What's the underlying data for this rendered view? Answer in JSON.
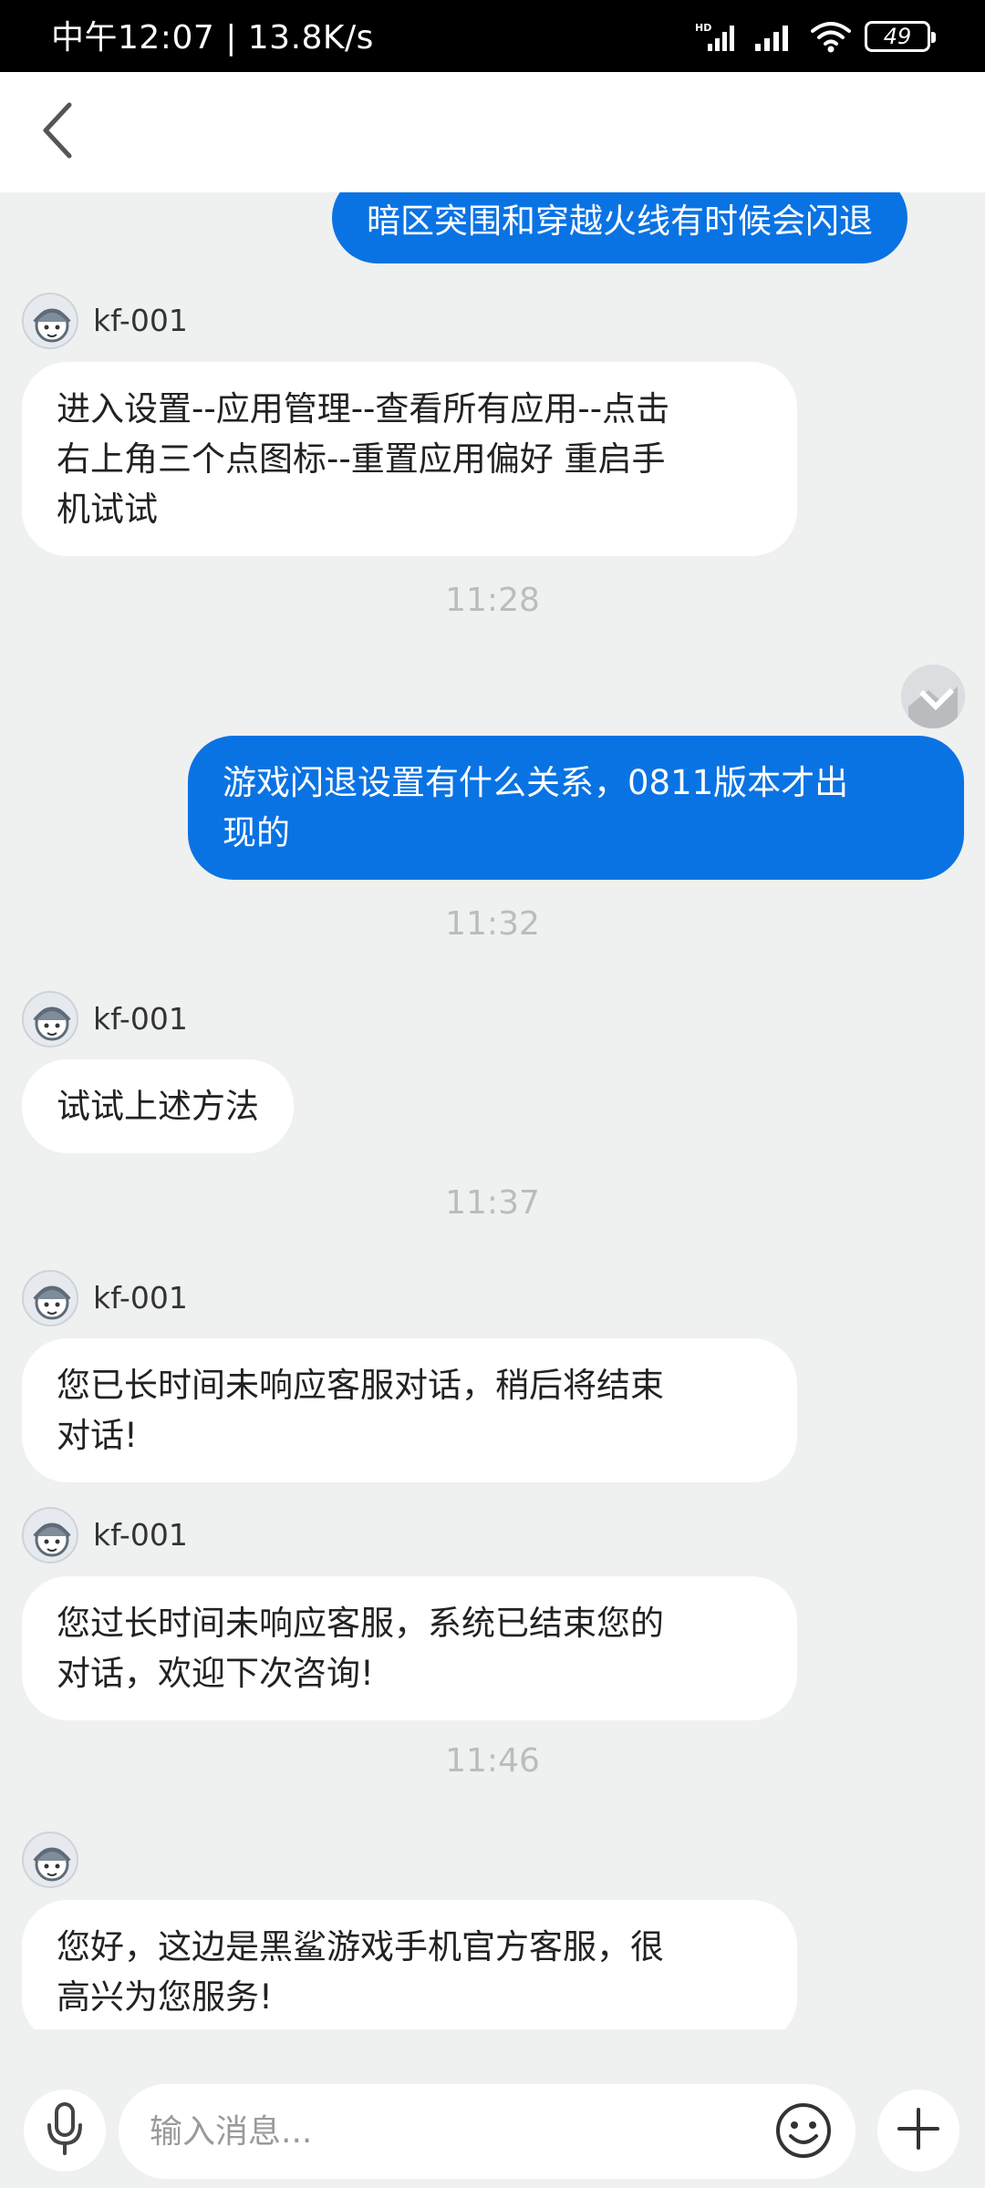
{
  "status_bar": {
    "time_speed": "中午12:07 | 13.8K/s",
    "battery": "49",
    "icons": [
      "hd-signal-icon",
      "signal-icon",
      "wifi-icon",
      "battery-icon"
    ]
  },
  "header": {
    "back_icon": "chevron-left-icon"
  },
  "messages": [
    {
      "from": "user",
      "text": "暗区突围和穿越火线有时候会闪退"
    },
    {
      "from": "agent",
      "sender": "kf-001",
      "text": "进入设置--应用管理--查看所有应用--点击\n右上角三个点图标--重置应用偏好 重启手\n机试试"
    },
    {
      "type": "time",
      "text": "11:28"
    },
    {
      "from": "user",
      "text": "游戏闪退设置有什么关系，0811版本才出\n现的"
    },
    {
      "type": "time",
      "text": "11:32"
    },
    {
      "from": "agent",
      "sender": "kf-001",
      "text": "试试上述方法"
    },
    {
      "type": "time",
      "text": "11:37"
    },
    {
      "from": "agent",
      "sender": "kf-001",
      "text": "您已长时间未响应客服对话，稍后将结束\n对话!"
    },
    {
      "from": "agent",
      "sender": "kf-001",
      "text": "您过长时间未响应客服，系统已结束您的\n对话，欢迎下次咨询!"
    },
    {
      "type": "time",
      "text": "11:46"
    },
    {
      "from": "agent",
      "sender": "",
      "text": "您好，这边是黑鲨游戏手机官方客服，很\n高兴为您服务!"
    }
  ],
  "input_bar": {
    "placeholder": "输入消息...",
    "icons": [
      "microphone-icon",
      "emoji-icon",
      "plus-icon"
    ]
  },
  "colors": {
    "user_bubble": "#0a73e3",
    "agent_bubble": "#ffffff",
    "background": "#eff0f0",
    "timestamp": "#bbbcbe"
  }
}
